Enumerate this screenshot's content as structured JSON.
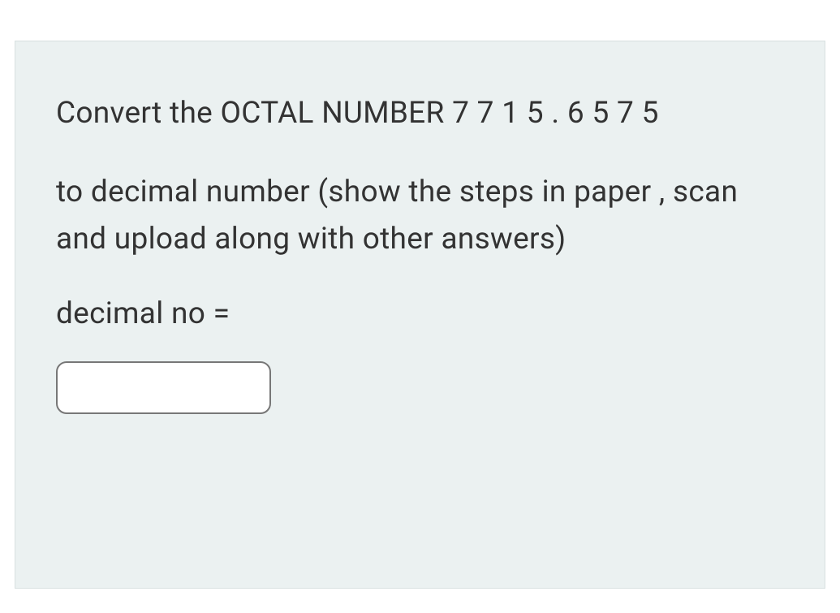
{
  "question": {
    "line1": "Convert the OCTAL NUMBER  7 7 1 5 . 6 5 7 5",
    "line2": "to decimal number (show the steps in paper , scan and upload along with other answers)",
    "line3": "decimal  no ="
  },
  "input": {
    "value": "",
    "placeholder": ""
  }
}
